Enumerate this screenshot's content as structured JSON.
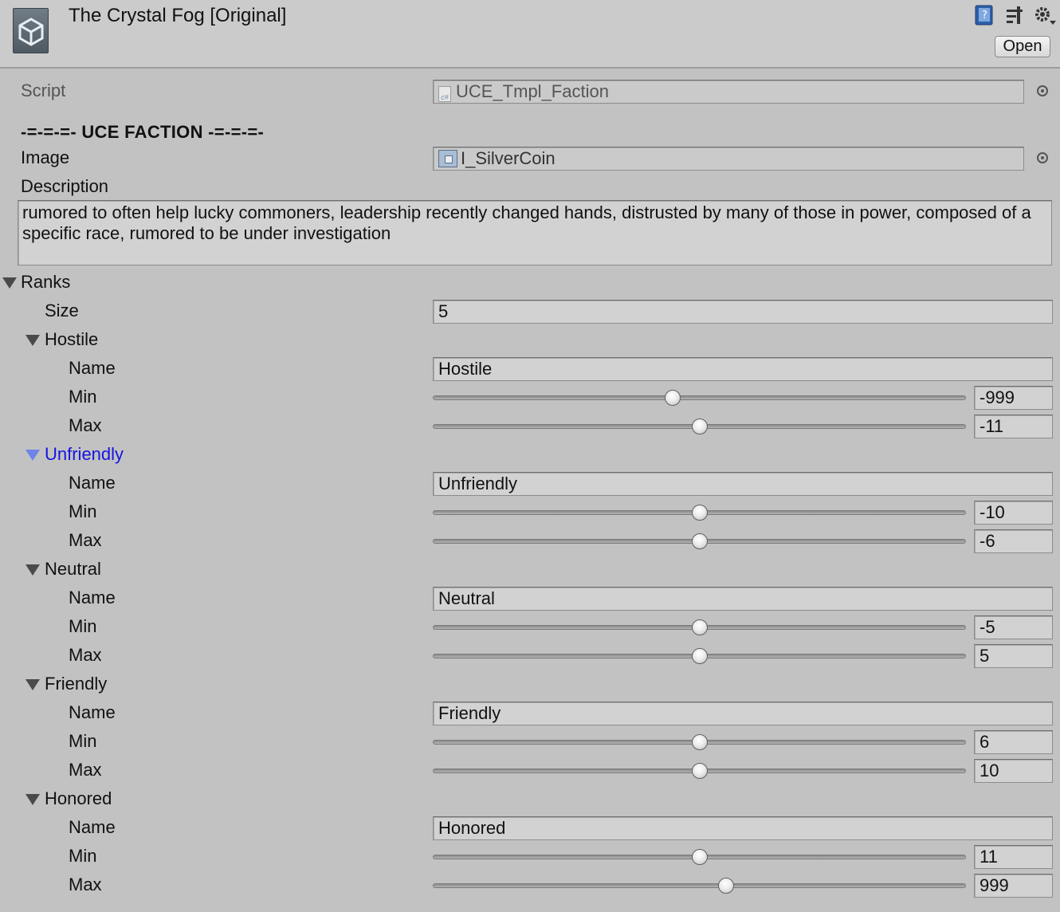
{
  "header": {
    "title": "The Crystal Fog [Original]",
    "open_label": "Open"
  },
  "script_field": {
    "label": "Script",
    "value": "UCE_Tmpl_Faction"
  },
  "section_header": "-=-=-=- UCE FACTION -=-=-=-",
  "image_field": {
    "label": "Image",
    "value": "I_SilverCoin"
  },
  "description": {
    "label": "Description",
    "value": "rumored to often help lucky commoners, leadership recently changed hands, distrusted by many of those in power, composed of a specific race, rumored to be under investigation"
  },
  "ranks": {
    "label": "Ranks",
    "size_label": "Size",
    "size_value": "5",
    "name_label": "Name",
    "min_label": "Min",
    "max_label": "Max",
    "items": [
      {
        "title": "Hostile",
        "name": "Hostile",
        "min": "-999",
        "max": "-11",
        "min_slider": 0.45,
        "max_slider": 0.5
      },
      {
        "title": "Unfriendly",
        "name": "Unfriendly",
        "min": "-10",
        "max": "-6",
        "min_slider": 0.5,
        "max_slider": 0.5
      },
      {
        "title": "Neutral",
        "name": "Neutral",
        "min": "-5",
        "max": "5",
        "min_slider": 0.5,
        "max_slider": 0.5
      },
      {
        "title": "Friendly",
        "name": "Friendly",
        "min": "6",
        "max": "10",
        "min_slider": 0.5,
        "max_slider": 0.5
      },
      {
        "title": "Honored",
        "name": "Honored",
        "min": "11",
        "max": "999",
        "min_slider": 0.5,
        "max_slider": 0.55
      }
    ]
  },
  "colors": {
    "selected_foldout": "#1515e0",
    "background": "#c2c2c2"
  }
}
